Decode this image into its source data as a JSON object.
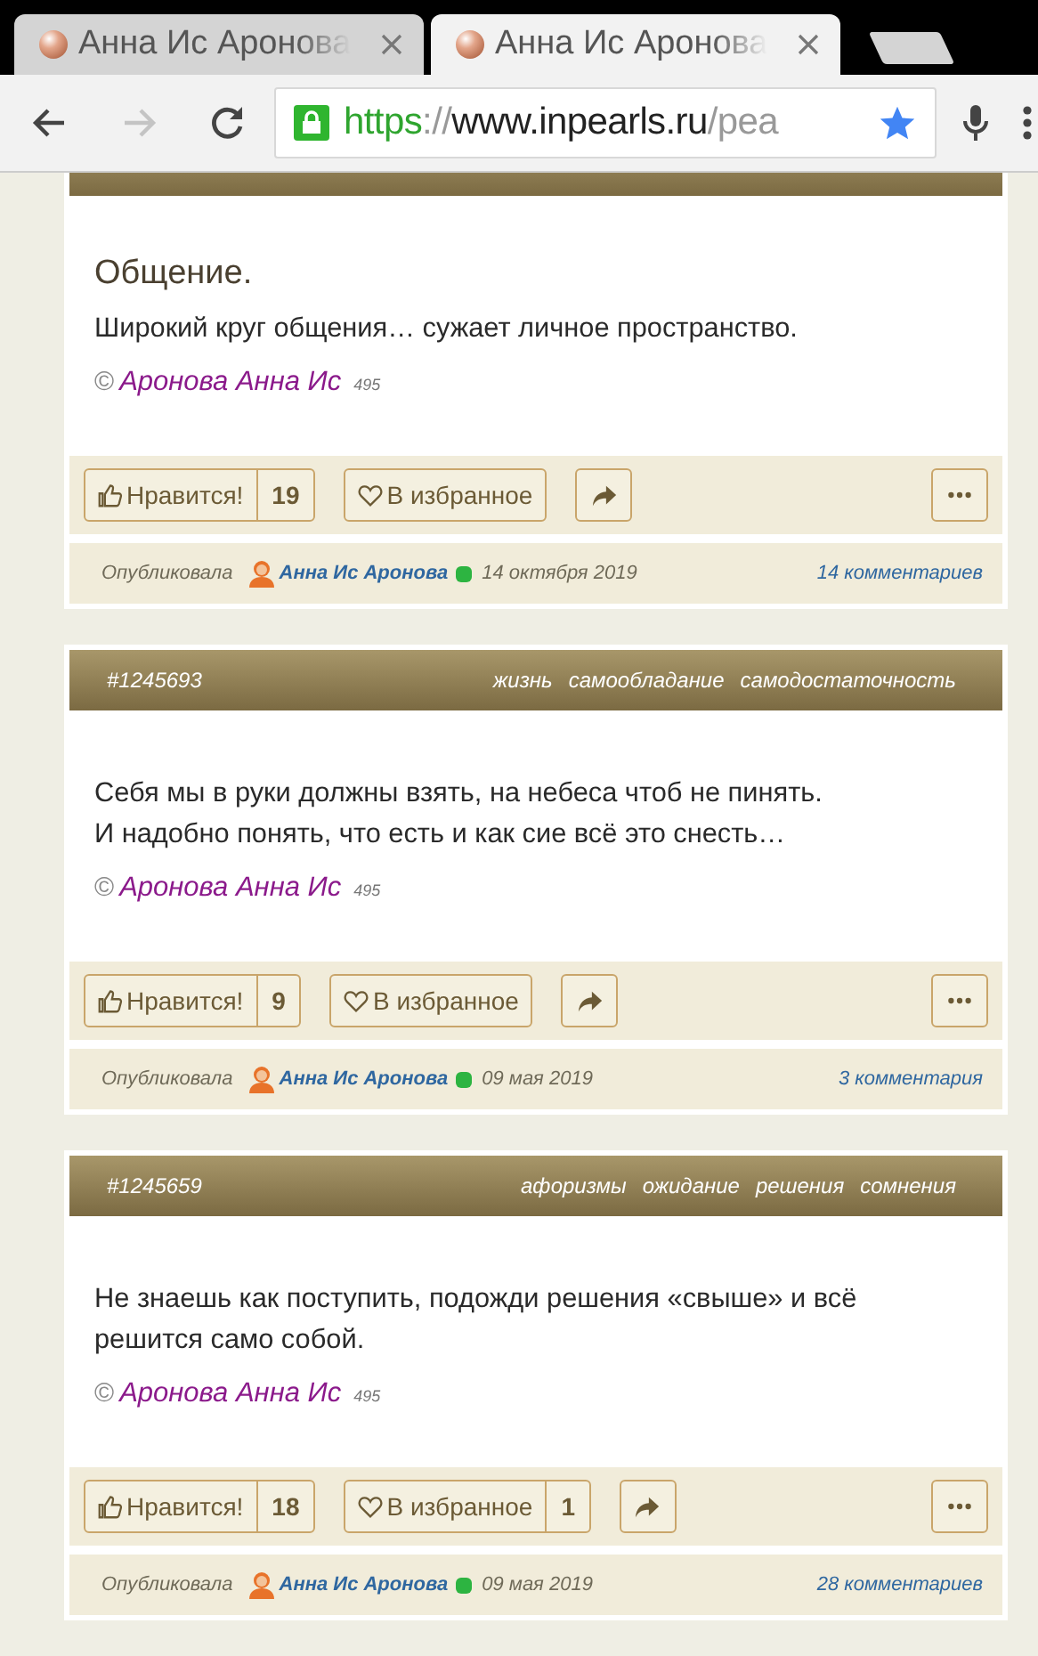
{
  "browser": {
    "tabs": [
      {
        "title": "Анна Ис Аронова",
        "selected": false
      },
      {
        "title": "Анна Ис Аронова",
        "selected": true
      }
    ],
    "url": {
      "scheme": "https",
      "separator": "://",
      "host": "www.inpearls.ru",
      "path": "/pea"
    }
  },
  "posts": [
    {
      "title": "Общение.",
      "lines": [
        "Широкий круг общения… сужает личное пространство."
      ],
      "copyright": "©",
      "author": "Аронова Анна Ис",
      "rating": "495",
      "like_label": "Нравится!",
      "like_count": "19",
      "fav_label": "В избранное",
      "published_label": "Опубликовала",
      "publisher": "Анна Ис Аронова",
      "online": true,
      "date": "14 октября 2019",
      "comments": "14 комментариев"
    },
    {
      "id": "#1245693",
      "tags": [
        "жизнь",
        "самообладание",
        "самодостаточность"
      ],
      "lines": [
        "Себя мы в руки должны взять, на небеса чтоб не пинять.",
        "И надобно понять, что есть и как сие всё это снесть…"
      ],
      "copyright": "©",
      "author": "Аронова Анна Ис",
      "rating": "495",
      "like_label": "Нравится!",
      "like_count": "9",
      "fav_label": "В избранное",
      "published_label": "Опубликовала",
      "publisher": "Анна Ис Аронова",
      "online": true,
      "date": "09 мая 2019",
      "comments": "3 комментария"
    },
    {
      "id": "#1245659",
      "tags": [
        "афоризмы",
        "ожидание",
        "решения",
        "сомнения"
      ],
      "lines": [
        "Не знаешь как поступить, подожди решения «свыше» и всё",
        "решится само собой."
      ],
      "copyright": "©",
      "author": "Аронова Анна Ис",
      "rating": "495",
      "like_label": "Нравится!",
      "like_count": "18",
      "fav_label": "В избранное",
      "fav_count": "1",
      "published_label": "Опубликовала",
      "publisher": "Анна Ис Аронова",
      "online": true,
      "date": "09 мая 2019",
      "comments": "28 комментариев"
    }
  ]
}
